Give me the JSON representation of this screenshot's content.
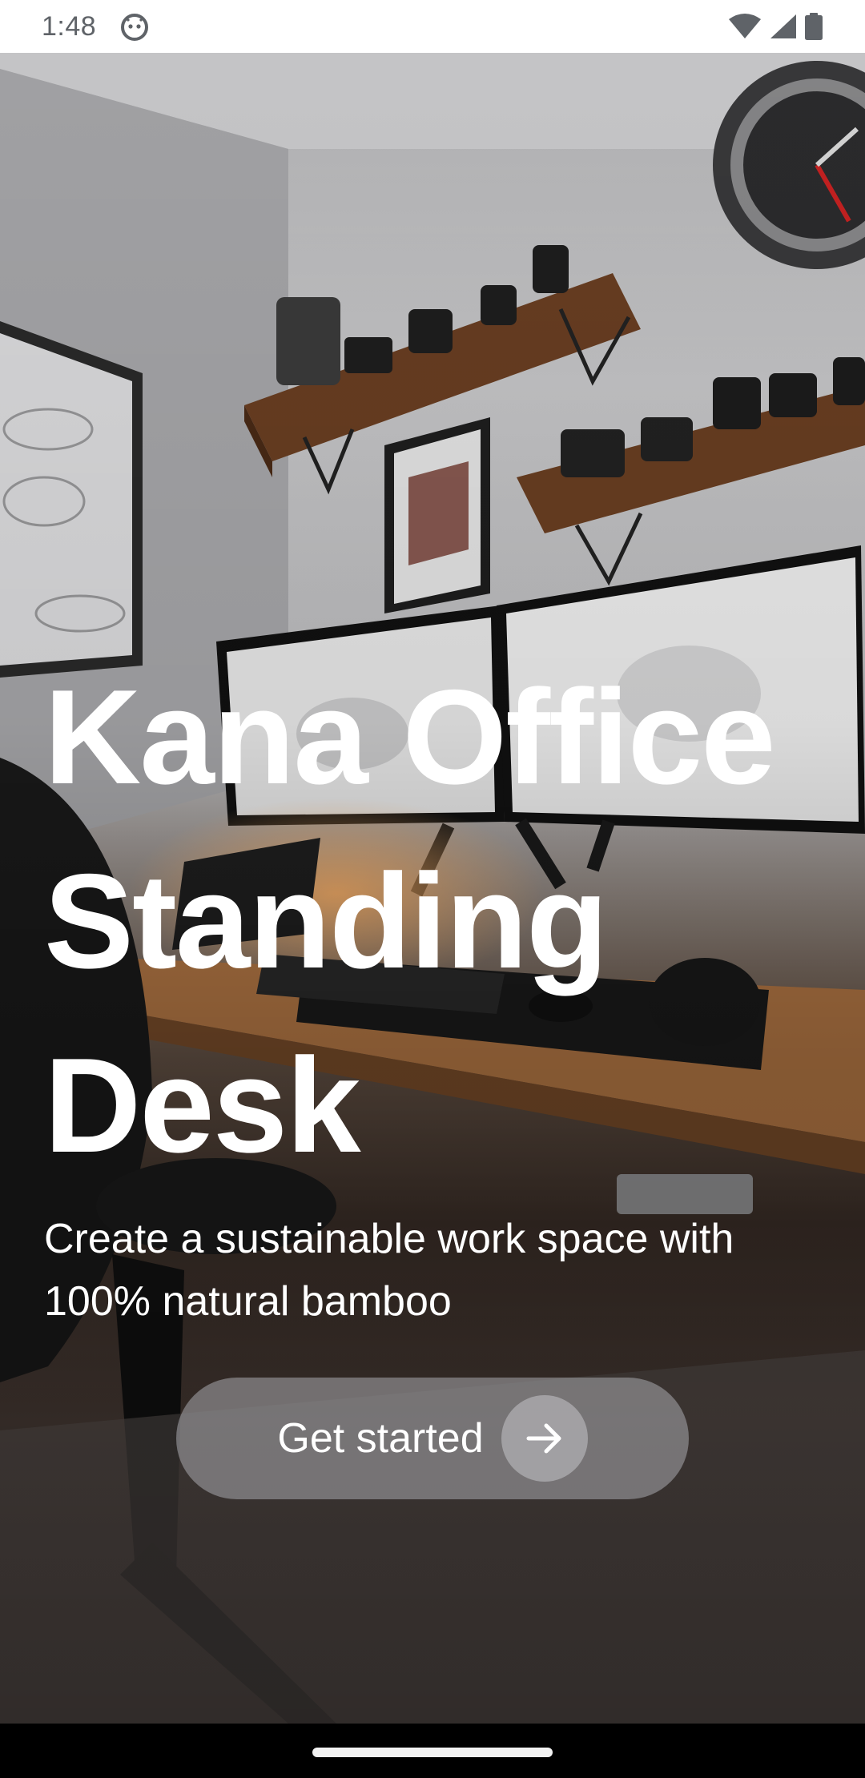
{
  "status_bar": {
    "time": "1:48",
    "app_icon": "android-robot-face-icon",
    "icons": [
      "wifi-icon",
      "cellular-signal-icon",
      "battery-icon"
    ]
  },
  "hero": {
    "image": "home office standing desk with dual monitors, wooden shelves with cameras, wall clock and framed prints",
    "headline": "Kana Office Standing Desk",
    "subtitle": "Create a sustainable work space with 100% natural bamboo"
  },
  "cta": {
    "label": "Get started",
    "icon": "arrow-right-icon"
  },
  "colors": {
    "text": "#ffffff",
    "status_text": "#5f6368",
    "cta_background": "rgba(170,170,175,0.55)"
  }
}
